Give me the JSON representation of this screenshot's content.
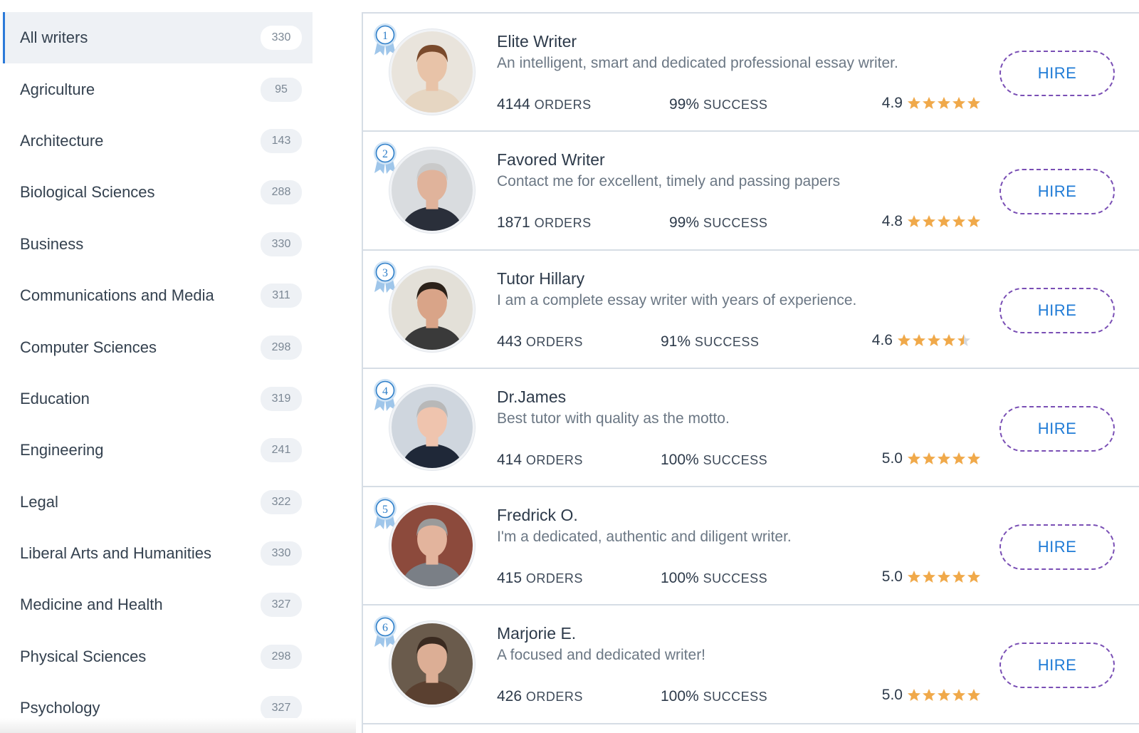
{
  "sidebar": {
    "categories": [
      {
        "label": "All writers",
        "count": "330",
        "active": true
      },
      {
        "label": "Agriculture",
        "count": "95"
      },
      {
        "label": "Architecture",
        "count": "143"
      },
      {
        "label": "Biological Sciences",
        "count": "288"
      },
      {
        "label": "Business",
        "count": "330"
      },
      {
        "label": "Communications and Media",
        "count": "311"
      },
      {
        "label": "Computer Sciences",
        "count": "298"
      },
      {
        "label": "Education",
        "count": "319"
      },
      {
        "label": "Engineering",
        "count": "241"
      },
      {
        "label": "Legal",
        "count": "322"
      },
      {
        "label": "Liberal Arts and Humanities",
        "count": "330"
      },
      {
        "label": "Medicine and Health",
        "count": "327"
      },
      {
        "label": "Physical Sciences",
        "count": "298"
      },
      {
        "label": "Psychology",
        "count": "327"
      }
    ]
  },
  "labels": {
    "orders": "ORDERS",
    "success": "SUCCESS",
    "hire": "HIRE"
  },
  "colors": {
    "accent": "#1f7bd6",
    "star": "#f0a94a",
    "badge": "#2f7fc9"
  },
  "writers": [
    {
      "rank": "1",
      "name": "Elite Writer",
      "description": "An intelligent, smart and dedicated professional essay writer.",
      "orders": "4144",
      "success": "99%",
      "rating": "4.9",
      "stars": 5
    },
    {
      "rank": "2",
      "name": "Favored Writer",
      "description": "Contact me for excellent, timely and passing papers",
      "orders": "1871",
      "success": "99%",
      "rating": "4.8",
      "stars": 5
    },
    {
      "rank": "3",
      "name": "Tutor Hillary",
      "description": "I am a complete essay writer with years of experience.",
      "orders": "443",
      "success": "91%",
      "rating": "4.6",
      "stars": 4.5
    },
    {
      "rank": "4",
      "name": "Dr.James",
      "description": "Best tutor with quality as the motto.",
      "orders": "414",
      "success": "100%",
      "rating": "5.0",
      "stars": 5
    },
    {
      "rank": "5",
      "name": "Fredrick O.",
      "description": "I'm a dedicated, authentic and diligent writer.",
      "orders": "415",
      "success": "100%",
      "rating": "5.0",
      "stars": 5
    },
    {
      "rank": "6",
      "name": "Marjorie E.",
      "description": "A focused and dedicated writer!",
      "orders": "426",
      "success": "100%",
      "rating": "5.0",
      "stars": 5
    }
  ]
}
